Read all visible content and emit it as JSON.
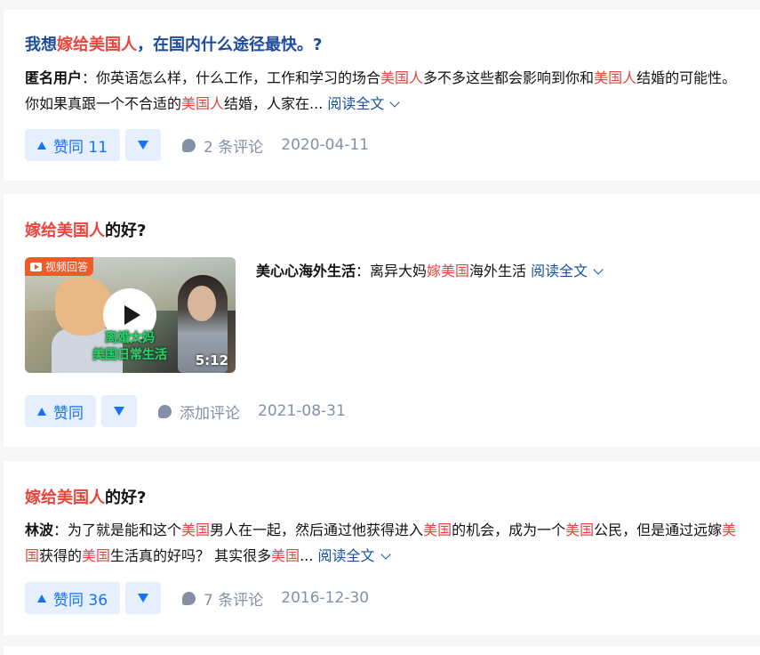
{
  "cards": [
    {
      "title_parts": [
        "我想",
        "嫁给美国人",
        "，在国内什么途径最快。?"
      ],
      "author": "匿名用户",
      "excerpt_parts": [
        "：你英语怎么样，什么工作，工作和学习的场合",
        "美国人",
        "多不多这些都会影响到你和",
        "美国人",
        "结婚的可能性。你如果真跟一个不合适的",
        "美国人",
        "结婚，人家在..."
      ],
      "read_more": "阅读全文",
      "vote_label": "赞同 11",
      "comment": "2 条评论",
      "date": "2020-04-11"
    },
    {
      "title_parts": [
        "嫁给美国人",
        "的好?"
      ],
      "video": {
        "badge": "视频回答",
        "caption_line1": "离婚大妈",
        "caption_line2": "美国日常生活",
        "duration": "5:12"
      },
      "author": "美心心海外生活",
      "excerpt_parts": [
        "：离异大妈",
        "嫁美国",
        "海外生活"
      ],
      "read_more": "阅读全文",
      "vote_label": "赞同",
      "comment": "添加评论",
      "date": "2021-08-31"
    },
    {
      "title_parts": [
        "嫁给美国人",
        "的好?"
      ],
      "author": "林波",
      "excerpt_parts": [
        "：为了就是能和这个",
        "美国",
        "男人在一起，然后通过他获得进入",
        "美国",
        "的机会，成为一个",
        "美国",
        "公民，但是通过远嫁",
        "美国",
        "获得的",
        "美国",
        "生活真的好吗？ 其实很多",
        "美国",
        "..."
      ],
      "read_more": "阅读全文",
      "vote_label": "赞同 36",
      "comment": "7 条评论",
      "date": "2016-12-30"
    }
  ],
  "colors": {
    "highlight": "#e8453c",
    "title_blue": "#1e4b9a",
    "link": "#175199",
    "vote_bg": "#e5effd",
    "vote_fg": "#1772f6",
    "meta": "#8590a6"
  },
  "icons": [
    "vote-up-icon",
    "vote-down-icon",
    "comment-icon",
    "chevron-down-icon",
    "play-icon",
    "video-badge-icon"
  ]
}
